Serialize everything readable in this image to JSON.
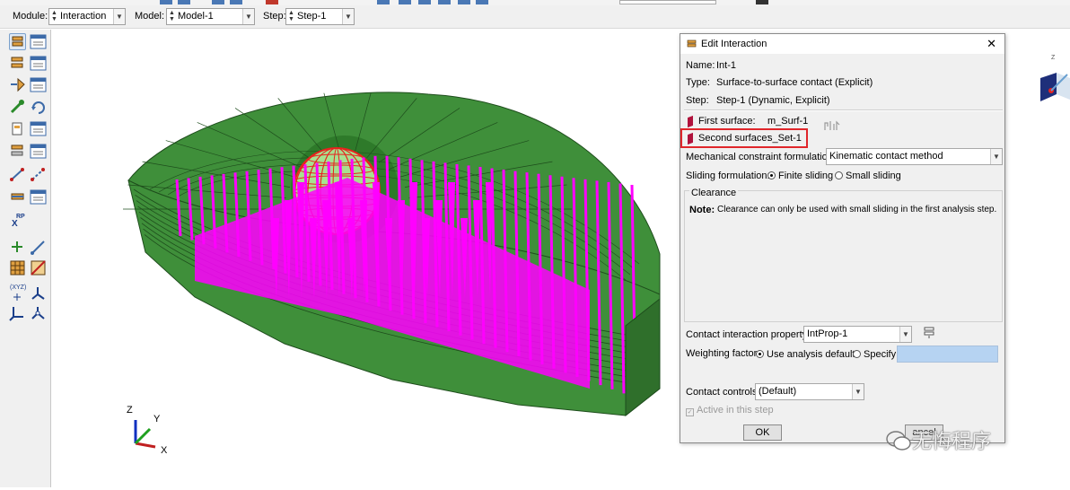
{
  "context_bar": {
    "module_label": "Module:",
    "module_value": "Interaction",
    "model_label": "Model:",
    "model_value": "Model-1",
    "step_label": "Step:",
    "step_value": "Step-1"
  },
  "toolbox": {
    "rp_label": "RP",
    "rp_sub": "X",
    "xyz_label": "(XYZ)"
  },
  "triad": {
    "z": "Z",
    "y": "Y",
    "x": "X"
  },
  "mini_triad": {
    "z": "Z"
  },
  "dialog": {
    "title": "Edit Interaction",
    "close": "✕",
    "name_label": "Name:",
    "name_value": "Int-1",
    "type_label": "Type:",
    "type_value": "Surface-to-surface contact (Explicit)",
    "step_label": "Step:",
    "step_value": "Step-1 (Dynamic, Explicit)",
    "first_surface_label": "First surface:",
    "first_surface_value": "m_Surf-1",
    "second_surface_label": "Second surface:",
    "second_surface_value": "s_Set-1",
    "mech_label": "Mechanical constraint formulation:",
    "mech_value": "Kinematic contact method",
    "sliding_label": "Sliding formulation:",
    "sliding_opt1": "Finite sliding",
    "sliding_opt2": "Small sliding",
    "clearance_title": "Clearance",
    "note_bold": "Note:",
    "note_text": "Clearance can only be used with small sliding in the first analysis step.",
    "prop_label": "Contact interaction property:",
    "prop_value": "IntProp-1",
    "weight_label": "Weighting factor",
    "weight_opt1": "Use analysis default",
    "weight_opt2": "Specify",
    "controls_label": "Contact controls:",
    "controls_value": "(Default)",
    "active_label": "Active in this step",
    "ok": "OK",
    "cancel": "ancel"
  },
  "watermark": "无悔程序",
  "colors": {
    "model_green": "#3f8f3a",
    "mesh_magenta": "#ff00ff",
    "sphere_red": "#e8231f",
    "highlight_red": "#e0262b"
  }
}
